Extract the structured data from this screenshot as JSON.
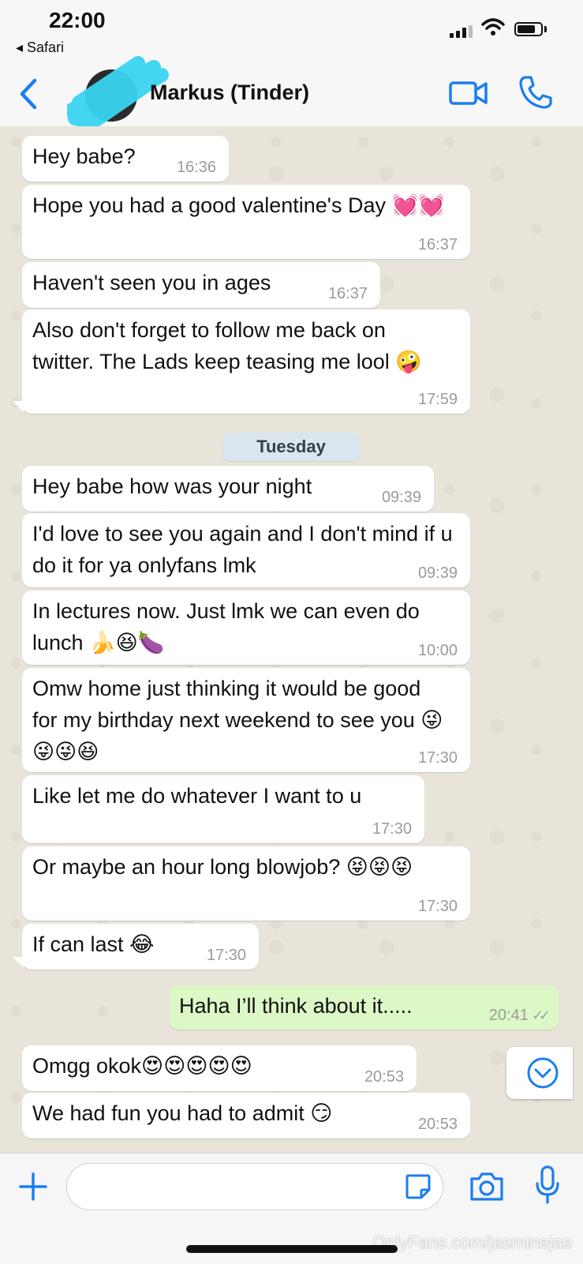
{
  "status_bar": {
    "time": "22:00",
    "back_app": "◂ Safari"
  },
  "header": {
    "contact_name": "Markus (Tinder)",
    "accent_color": "#1c7ef0"
  },
  "messages": [
    {
      "text": "Hey babe?",
      "time": "16:36",
      "direction": "in"
    },
    {
      "text": "Hope you had a good valentine's Day 💓💓",
      "time": "16:37",
      "direction": "in"
    },
    {
      "text": "Haven't seen you in ages",
      "time": "16:37",
      "direction": "in"
    },
    {
      "text": "Also don't forget to follow me back on twitter. The Lads keep teasing me lool 🤪",
      "time": "17:59",
      "direction": "in"
    },
    {
      "text": "Hey babe how was your night",
      "time": "09:39",
      "direction": "in"
    },
    {
      "text": "I'd love to see you again and I don't mind if u do it for ya onlyfans lmk",
      "time": "09:39",
      "direction": "in"
    },
    {
      "text": "In lectures now. Just lmk we can even do lunch 🍌😆🍆",
      "time": "10:00",
      "direction": "in"
    },
    {
      "text": "Omw home just thinking it would be good for my birthday next weekend to see you 😜😜😜😆",
      "time": "17:30",
      "direction": "in"
    },
    {
      "text": "Like let me do whatever I want to u",
      "time": "17:30",
      "direction": "in"
    },
    {
      "text": "Or maybe an hour long blowjob? 😝😝😝",
      "time": "17:30",
      "direction": "in"
    },
    {
      "text": "If can last 😂",
      "time": "17:30",
      "direction": "in"
    },
    {
      "text": "Haha I’ll think about it.....",
      "time": "20:41",
      "direction": "out"
    },
    {
      "text": "Omgg okok😍😍😍😍😍",
      "time": "20:53",
      "direction": "in"
    },
    {
      "text": "We had fun you had to admit 😏",
      "time": "20:53",
      "direction": "in"
    }
  ],
  "date_separator": "Tuesday",
  "watermark": "OnlyFans.com/jasminejae",
  "icons": {
    "back": "chevron-left-icon",
    "video": "video-camera-icon",
    "call": "phone-icon",
    "plus": "plus-icon",
    "sticker": "sticker-icon",
    "camera": "camera-icon",
    "mic": "microphone-icon",
    "scroll": "chevron-down-circle-icon"
  }
}
